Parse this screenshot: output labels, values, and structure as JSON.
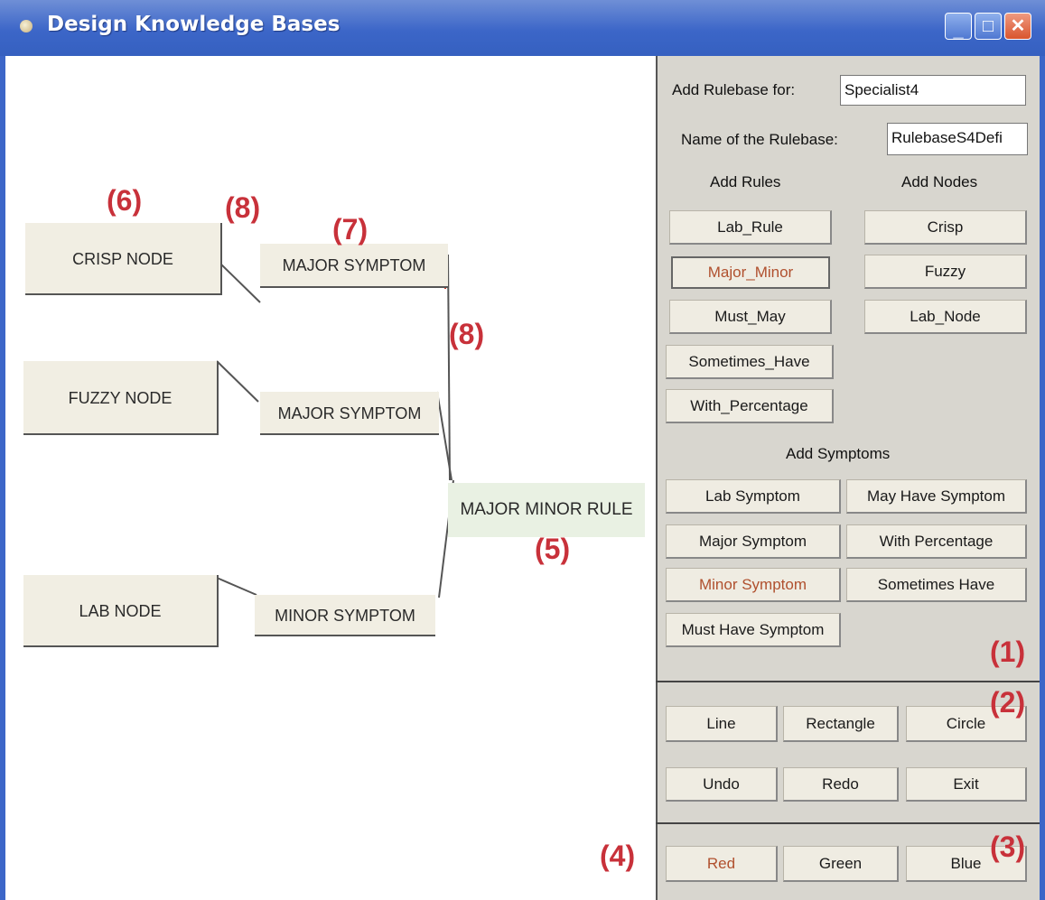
{
  "window": {
    "title": "Design Knowledge Bases"
  },
  "canvas": {
    "nodes": [
      "CRISP NODE",
      "FUZZY NODE",
      "LAB NODE"
    ],
    "symptoms": [
      "MAJOR SYMPTOM",
      "MAJOR SYMPTOM",
      "MINOR SYMPTOM"
    ],
    "rule": "MAJOR MINOR RULE"
  },
  "annotations": {
    "a1": "(1)",
    "a2": "(2)",
    "a3": "(3)",
    "a4": "(4)",
    "a5": "(5)",
    "a6": "(6)",
    "a7": "(7)",
    "a8a": "(8)",
    "a8b": "(8)"
  },
  "panel": {
    "rulebase_for_label": "Add Rulebase for:",
    "rulebase_for_value": "Specialist4",
    "rulebase_name_label": "Name of the Rulebase:",
    "rulebase_name_value": "RulebaseS4Defi",
    "add_rules_heading": "Add Rules",
    "add_nodes_heading": "Add Nodes",
    "rules": [
      "Lab_Rule",
      "Major_Minor",
      "Must_May",
      "Sometimes_Have",
      "With_Percentage"
    ],
    "nodes": [
      "Crisp",
      "Fuzzy",
      "Lab_Node"
    ],
    "add_symptoms_heading": "Add Symptoms",
    "symptoms": [
      "Lab Symptom",
      "May Have Symptom",
      "Major Symptom",
      "With Percentage",
      "Minor Symptom",
      "Sometimes Have",
      "Must Have Symptom"
    ],
    "shapes": [
      "Line",
      "Rectangle",
      "Circle"
    ],
    "actions": [
      "Undo",
      "Redo",
      "Exit"
    ],
    "colors": [
      "Red",
      "Green",
      "Blue"
    ]
  }
}
